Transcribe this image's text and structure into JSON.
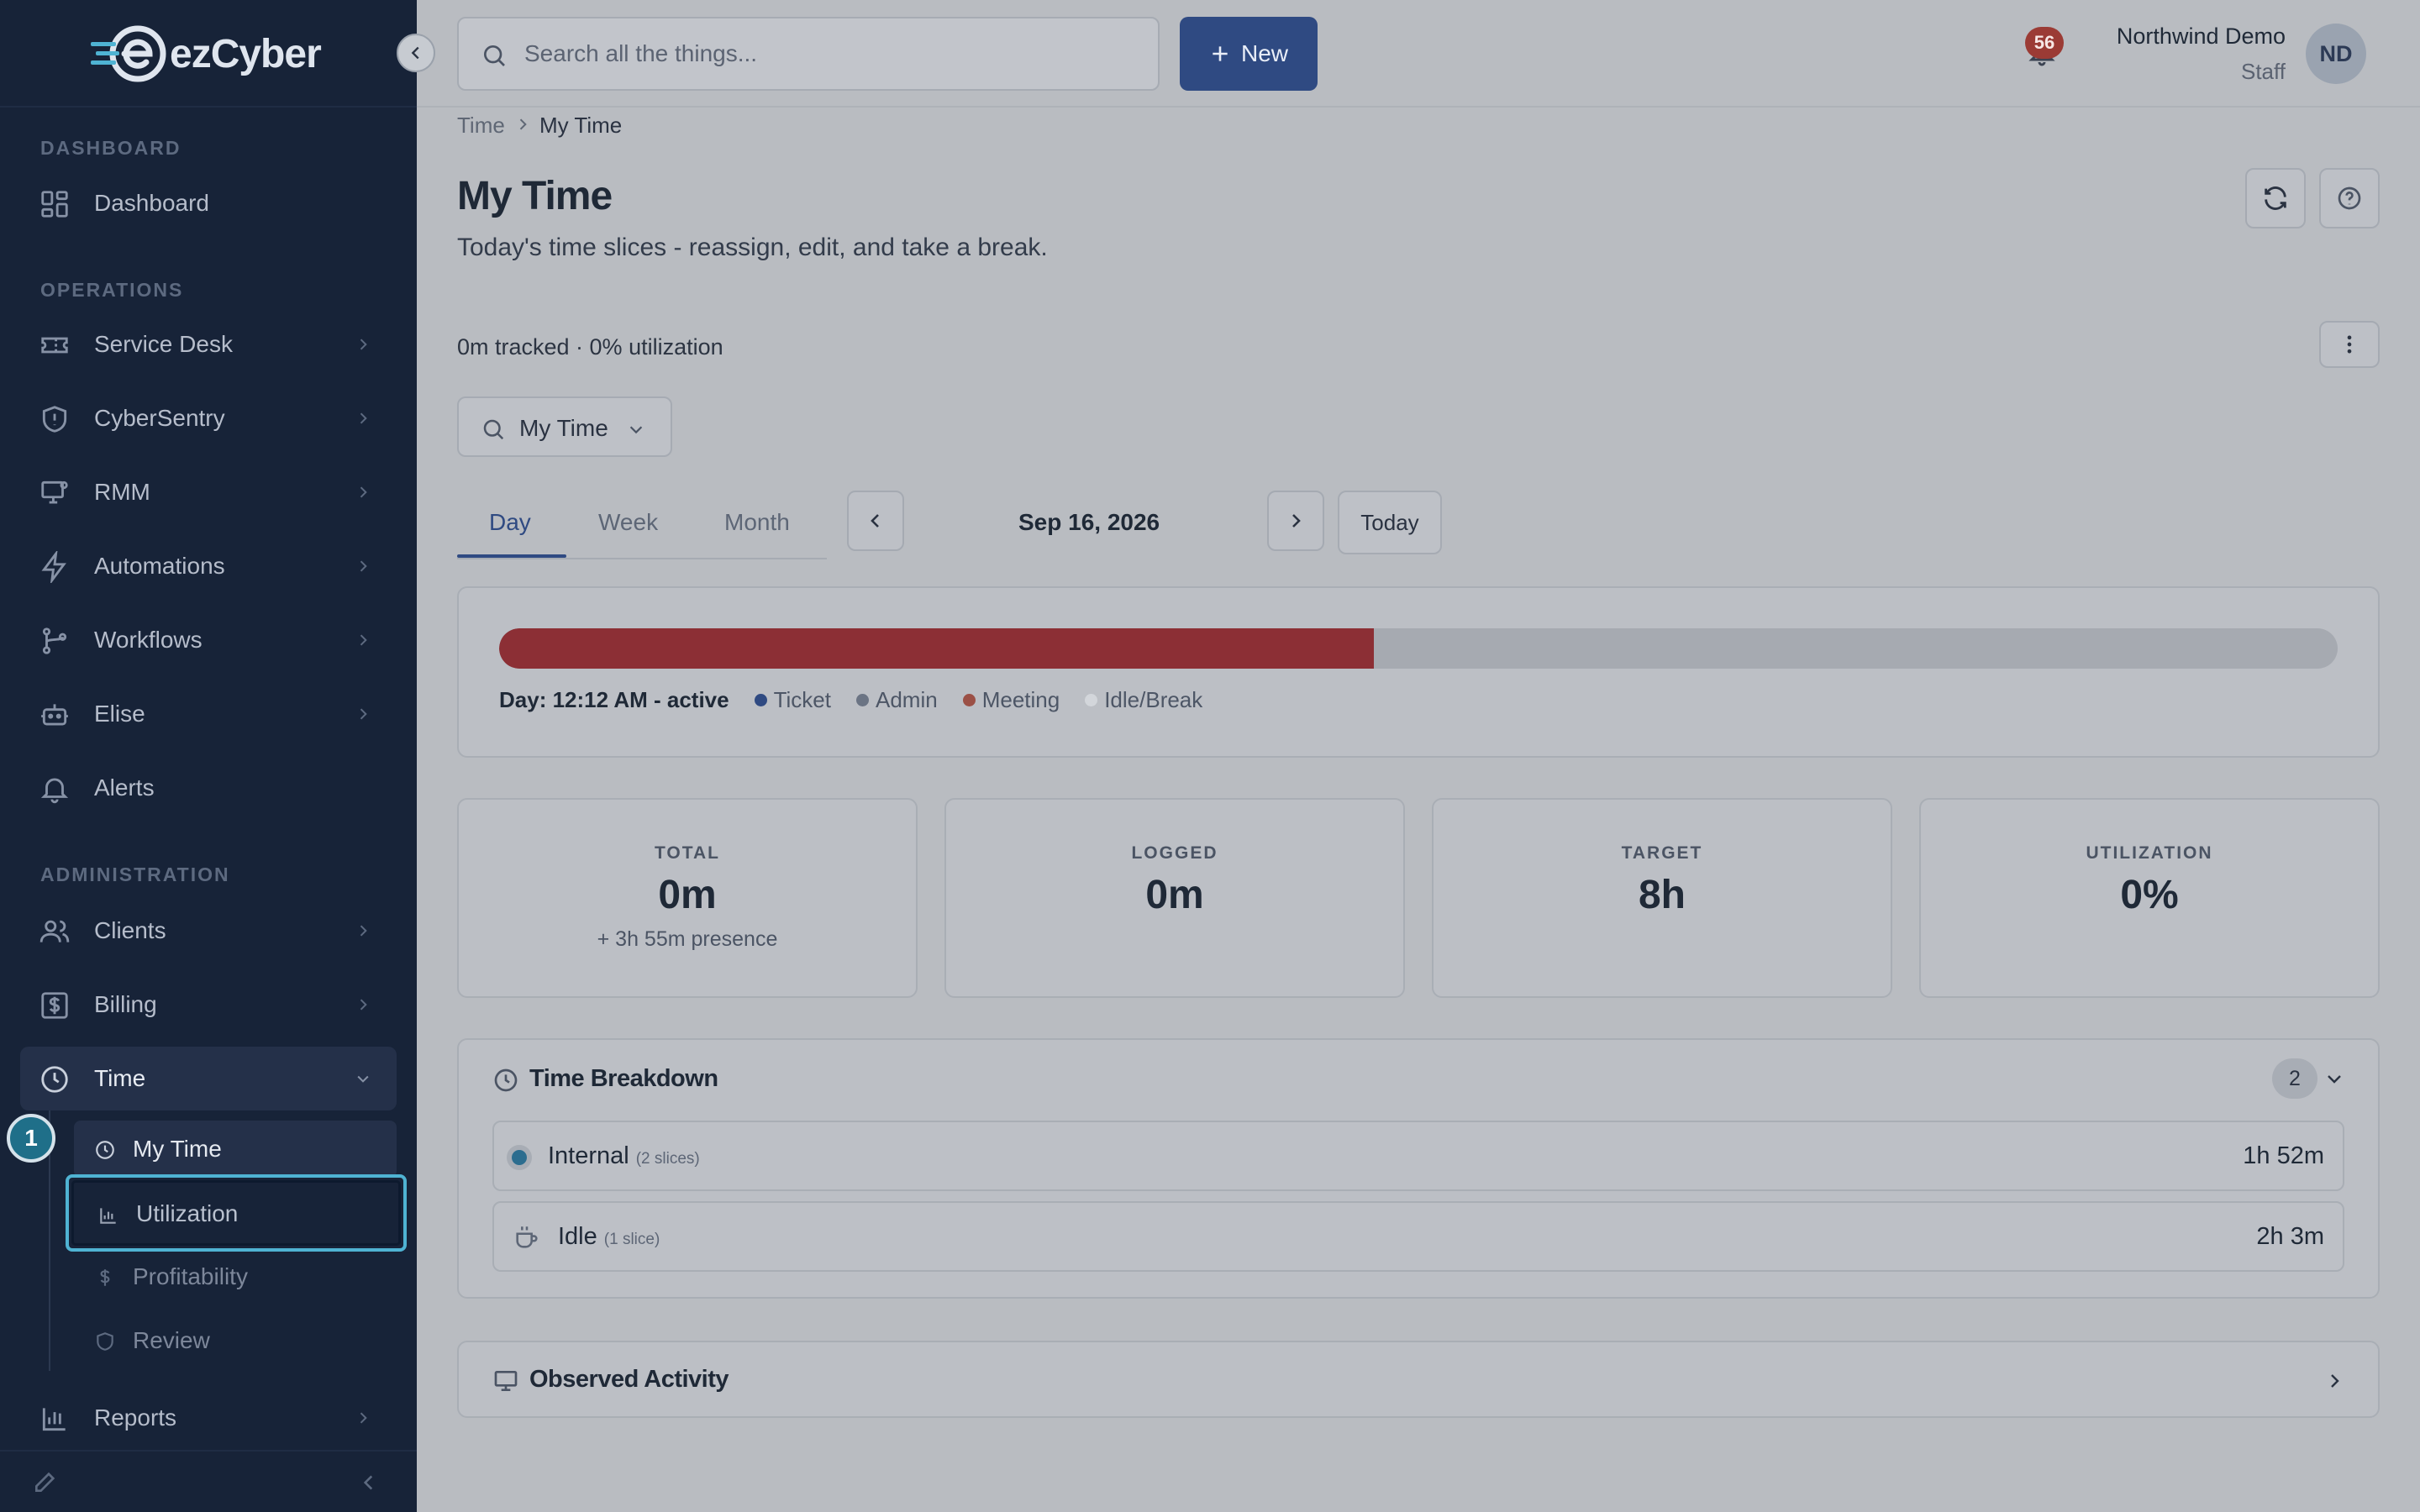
{
  "brand": {
    "name": "ezCyber",
    "accent": "#4fb3d3"
  },
  "sidebar": {
    "sections": {
      "dashboard": "DASHBOARD",
      "operations": "OPERATIONS",
      "administration": "ADMINISTRATION"
    },
    "items": {
      "dashboard": "Dashboard",
      "service_desk": "Service Desk",
      "cybersentry": "CyberSentry",
      "rmm": "RMM",
      "automations": "Automations",
      "workflows": "Workflows",
      "elise": "Elise",
      "alerts": "Alerts",
      "clients": "Clients",
      "billing": "Billing",
      "time": "Time",
      "reports": "Reports"
    },
    "time_sub": {
      "my_time": "My Time",
      "utilization": "Utilization",
      "profitability": "Profitability",
      "review": "Review"
    },
    "step_badge": "1"
  },
  "topbar": {
    "search_placeholder": "Search all the things...",
    "new_label": "New",
    "notification_count": "56",
    "user_name": "Northwind Demo",
    "user_role": "Staff",
    "avatar_initials": "ND"
  },
  "page": {
    "breadcrumb": [
      "Time",
      "My Time"
    ],
    "title": "My Time",
    "subtitle": "Today's time slices - reassign, edit, and take a break.",
    "summary": "0m tracked · 0% utilization",
    "filter_label": "My Time",
    "tabs": [
      "Day",
      "Week",
      "Month"
    ],
    "active_tab": "Day",
    "date": "Sep 16, 2026",
    "today_label": "Today"
  },
  "timeline": {
    "fill_fraction": 0.476,
    "fill_color": "#8c2f35",
    "day_status": "Day: 12:12 AM - active",
    "legend": [
      {
        "label": "Ticket",
        "color": "#2f4a82"
      },
      {
        "label": "Admin",
        "color": "#6b7484"
      },
      {
        "label": "Meeting",
        "color": "#9b5046"
      },
      {
        "label": "Idle/Break",
        "color": "#d3d6db"
      }
    ]
  },
  "stats": [
    {
      "label": "TOTAL",
      "value": "0m",
      "note": "+ 3h 55m presence"
    },
    {
      "label": "LOGGED",
      "value": "0m",
      "note": ""
    },
    {
      "label": "TARGET",
      "value": "8h",
      "note": ""
    },
    {
      "label": "UTILIZATION",
      "value": "0%",
      "note": ""
    }
  ],
  "breakdown": {
    "title": "Time Breakdown",
    "count": "2",
    "rows": [
      {
        "name": "Internal",
        "meta": "(2 slices)",
        "value": "1h 52m"
      },
      {
        "name": "Idle",
        "meta": "(1 slice)",
        "value": "2h 3m"
      }
    ]
  },
  "observed": {
    "title": "Observed Activity"
  }
}
